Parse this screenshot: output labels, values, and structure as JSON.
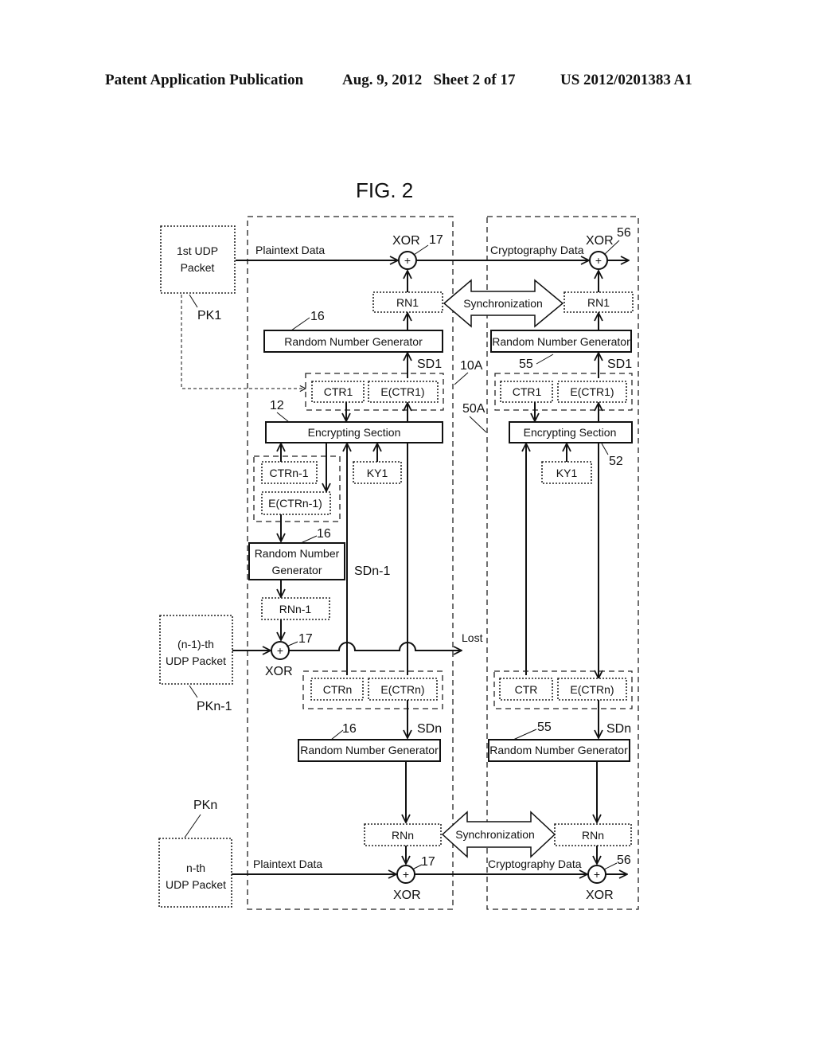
{
  "header": {
    "publication": "Patent Application Publication",
    "date_sheet": "Aug. 9, 2012   Sheet 2 of 17",
    "number": "US 2012/0201383 A1"
  },
  "figure": {
    "title": "FIG. 2",
    "packets": {
      "pk1_line1": "1st UDP",
      "pk1_line2": "Packet",
      "pk1_ref": "PK1",
      "pkn1_line1": "(n-1)-th",
      "pkn1_line2": "UDP Packet",
      "pkn1_ref": "PKn-1",
      "pkn_line1": "n-th",
      "pkn_line2": "UDP Packet",
      "pkn_ref": "PKn"
    },
    "sender": {
      "ref_unit": "10A",
      "plaintext_label": "Plaintext Data",
      "xor_label": "XOR",
      "xor_ref": "17",
      "rng_label": "Random Number Generator",
      "rng_ref": "16",
      "rng_split_line1": "Random Number",
      "rng_split_line2": "Generator",
      "enc_label": "Encrypting Section",
      "enc_ref": "12",
      "rn1": "RN1",
      "sd1": "SD1",
      "ctr1": "CTR1",
      "ectr1": "E(CTR1)",
      "ctrn1": "CTRn-1",
      "ectrn1": "E(CTRn-1)",
      "ky1": "KY1",
      "rnn1": "RNn-1",
      "sdn1": "SDn-1",
      "ctrn": "CTRn",
      "ectrn": "E(CTRn)",
      "sdn": "SDn",
      "rnn": "RNn",
      "lost": "Lost"
    },
    "receiver": {
      "ref_unit": "50A",
      "crypto_label": "Cryptography Data",
      "xor_label": "XOR",
      "xor_ref": "56",
      "rng_label": "Random Number Generator",
      "rng_ref": "55",
      "enc_label": "Encrypting Section",
      "enc_ref": "52",
      "rn1": "RN1",
      "sd1": "SD1",
      "ctr1": "CTR1",
      "ectr1": "E(CTR1)",
      "ky1": "KY1",
      "ctr": "CTR",
      "ectrn": "E(CTRn)",
      "sdn": "SDn",
      "rnn": "RNn"
    },
    "sync_label": "Synchronization",
    "xor_symbol": "+"
  }
}
